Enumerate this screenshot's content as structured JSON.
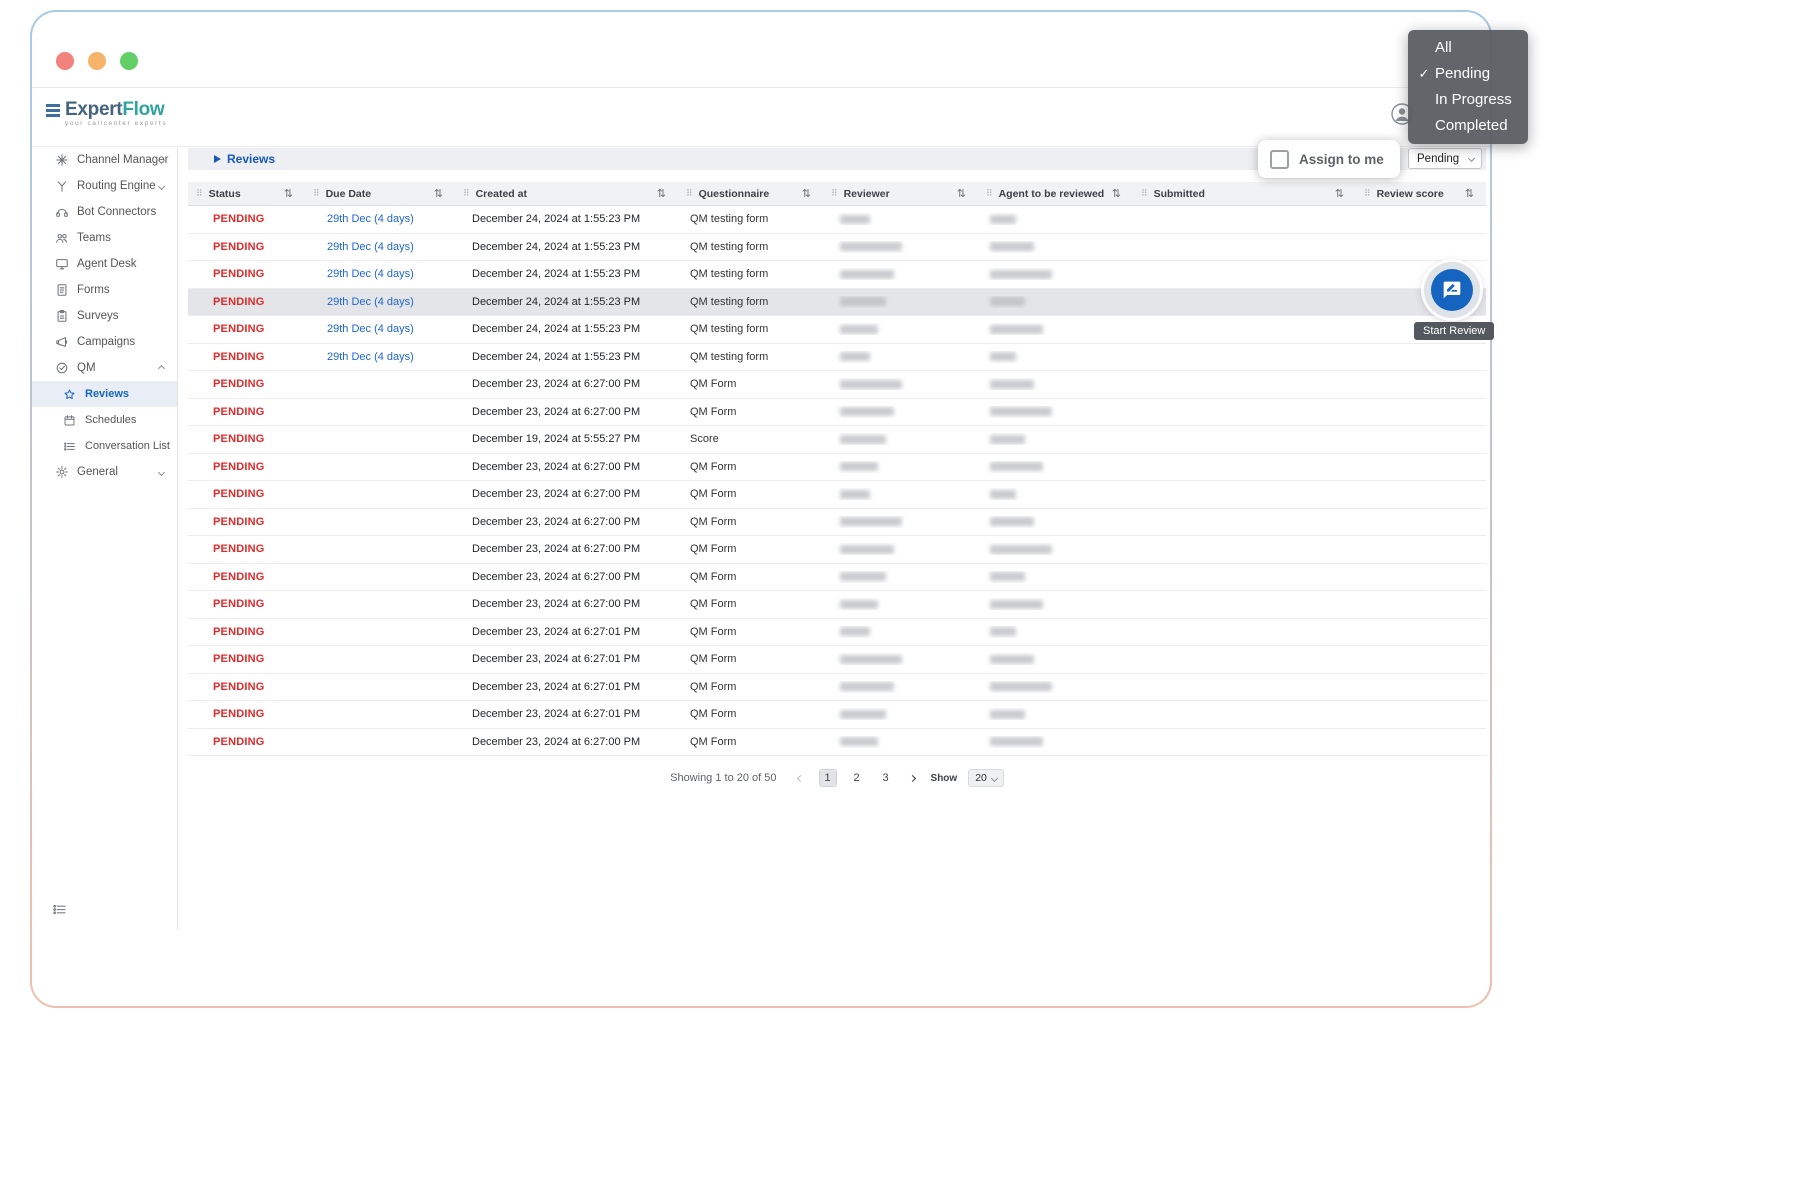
{
  "header": {
    "logo_primary": "Expert",
    "logo_secondary": "Flow",
    "tagline": "your callcenter experts"
  },
  "status_menu": {
    "items": [
      {
        "label": "All",
        "check": ""
      },
      {
        "label": "Pending",
        "check": "✓"
      },
      {
        "label": "In Progress",
        "check": ""
      },
      {
        "label": "Completed",
        "check": ""
      }
    ]
  },
  "sidebar": {
    "items": [
      {
        "label": "Channel Manager"
      },
      {
        "label": "Routing Engine"
      },
      {
        "label": "Bot Connectors"
      },
      {
        "label": "Teams"
      },
      {
        "label": "Agent Desk"
      },
      {
        "label": "Forms"
      },
      {
        "label": "Surveys"
      },
      {
        "label": "Campaigns"
      },
      {
        "label": "QM"
      },
      {
        "label": "General"
      }
    ],
    "qm_children": [
      {
        "label": "Reviews",
        "active": true
      },
      {
        "label": "Schedules",
        "active": false
      },
      {
        "label": "Conversation List",
        "active": false
      }
    ]
  },
  "toolbar": {
    "breadcrumb": "Reviews",
    "assign_to_me": "Assign to me",
    "filter_selected": "Pending"
  },
  "table": {
    "columns": [
      "Status",
      "Due Date",
      "Created at",
      "Questionnaire",
      "Reviewer",
      "Agent to be reviewed",
      "Submitted",
      "Review score"
    ],
    "highlighted_row_index": 3,
    "rows": [
      {
        "status": "PENDING",
        "due": "29th Dec (4 days)",
        "created": "December 24, 2024 at 1:55:23 PM",
        "questionnaire": "QM testing form",
        "reviewer_redacted": true,
        "agent_redacted": true,
        "submitted": "",
        "review_score": ""
      },
      {
        "status": "PENDING",
        "due": "29th Dec (4 days)",
        "created": "December 24, 2024 at 1:55:23 PM",
        "questionnaire": "QM testing form",
        "reviewer_redacted": true,
        "agent_redacted": true,
        "submitted": "",
        "review_score": ""
      },
      {
        "status": "PENDING",
        "due": "29th Dec (4 days)",
        "created": "December 24, 2024 at 1:55:23 PM",
        "questionnaire": "QM testing form",
        "reviewer_redacted": true,
        "agent_redacted": true,
        "submitted": "",
        "review_score": ""
      },
      {
        "status": "PENDING",
        "due": "29th Dec (4 days)",
        "created": "December 24, 2024 at 1:55:23 PM",
        "questionnaire": "QM testing form",
        "reviewer_redacted": true,
        "agent_redacted": true,
        "submitted": "",
        "review_score": ""
      },
      {
        "status": "PENDING",
        "due": "29th Dec (4 days)",
        "created": "December 24, 2024 at 1:55:23 PM",
        "questionnaire": "QM testing form",
        "reviewer_redacted": true,
        "agent_redacted": true,
        "submitted": "",
        "review_score": ""
      },
      {
        "status": "PENDING",
        "due": "29th Dec (4 days)",
        "created": "December 24, 2024 at 1:55:23 PM",
        "questionnaire": "QM testing form",
        "reviewer_redacted": true,
        "agent_redacted": true,
        "submitted": "",
        "review_score": ""
      },
      {
        "status": "PENDING",
        "due": "",
        "created": "December 23, 2024 at 6:27:00 PM",
        "questionnaire": "QM Form",
        "reviewer_redacted": true,
        "agent_redacted": true,
        "submitted": "",
        "review_score": ""
      },
      {
        "status": "PENDING",
        "due": "",
        "created": "December 23, 2024 at 6:27:00 PM",
        "questionnaire": "QM Form",
        "reviewer_redacted": true,
        "agent_redacted": true,
        "submitted": "",
        "review_score": ""
      },
      {
        "status": "PENDING",
        "due": "",
        "created": "December 19, 2024 at 5:55:27 PM",
        "questionnaire": "Score",
        "reviewer_redacted": true,
        "agent_redacted": true,
        "submitted": "",
        "review_score": ""
      },
      {
        "status": "PENDING",
        "due": "",
        "created": "December 23, 2024 at 6:27:00 PM",
        "questionnaire": "QM Form",
        "reviewer_redacted": true,
        "agent_redacted": true,
        "submitted": "",
        "review_score": ""
      },
      {
        "status": "PENDING",
        "due": "",
        "created": "December 23, 2024 at 6:27:00 PM",
        "questionnaire": "QM Form",
        "reviewer_redacted": true,
        "agent_redacted": true,
        "submitted": "",
        "review_score": ""
      },
      {
        "status": "PENDING",
        "due": "",
        "created": "December 23, 2024 at 6:27:00 PM",
        "questionnaire": "QM Form",
        "reviewer_redacted": true,
        "agent_redacted": true,
        "submitted": "",
        "review_score": ""
      },
      {
        "status": "PENDING",
        "due": "",
        "created": "December 23, 2024 at 6:27:00 PM",
        "questionnaire": "QM Form",
        "reviewer_redacted": true,
        "agent_redacted": true,
        "submitted": "",
        "review_score": ""
      },
      {
        "status": "PENDING",
        "due": "",
        "created": "December 23, 2024 at 6:27:00 PM",
        "questionnaire": "QM Form",
        "reviewer_redacted": true,
        "agent_redacted": true,
        "submitted": "",
        "review_score": ""
      },
      {
        "status": "PENDING",
        "due": "",
        "created": "December 23, 2024 at 6:27:00 PM",
        "questionnaire": "QM Form",
        "reviewer_redacted": true,
        "agent_redacted": true,
        "submitted": "",
        "review_score": ""
      },
      {
        "status": "PENDING",
        "due": "",
        "created": "December 23, 2024 at 6:27:01 PM",
        "questionnaire": "QM Form",
        "reviewer_redacted": true,
        "agent_redacted": true,
        "submitted": "",
        "review_score": ""
      },
      {
        "status": "PENDING",
        "due": "",
        "created": "December 23, 2024 at 6:27:01 PM",
        "questionnaire": "QM Form",
        "reviewer_redacted": true,
        "agent_redacted": true,
        "submitted": "",
        "review_score": ""
      },
      {
        "status": "PENDING",
        "due": "",
        "created": "December 23, 2024 at 6:27:01 PM",
        "questionnaire": "QM Form",
        "reviewer_redacted": true,
        "agent_redacted": true,
        "submitted": "",
        "review_score": ""
      },
      {
        "status": "PENDING",
        "due": "",
        "created": "December 23, 2024 at 6:27:01 PM",
        "questionnaire": "QM Form",
        "reviewer_redacted": true,
        "agent_redacted": true,
        "submitted": "",
        "review_score": ""
      },
      {
        "status": "PENDING",
        "due": "",
        "created": "December 23, 2024 at 6:27:00 PM",
        "questionnaire": "QM Form",
        "reviewer_redacted": true,
        "agent_redacted": true,
        "submitted": "",
        "review_score": ""
      }
    ]
  },
  "fab": {
    "tooltip": "Start Review"
  },
  "pagination": {
    "summary": "Showing 1 to 20 of 50",
    "pages": [
      "1",
      "2",
      "3"
    ],
    "active_page": "1",
    "show_label": "Show",
    "page_size": "20"
  }
}
